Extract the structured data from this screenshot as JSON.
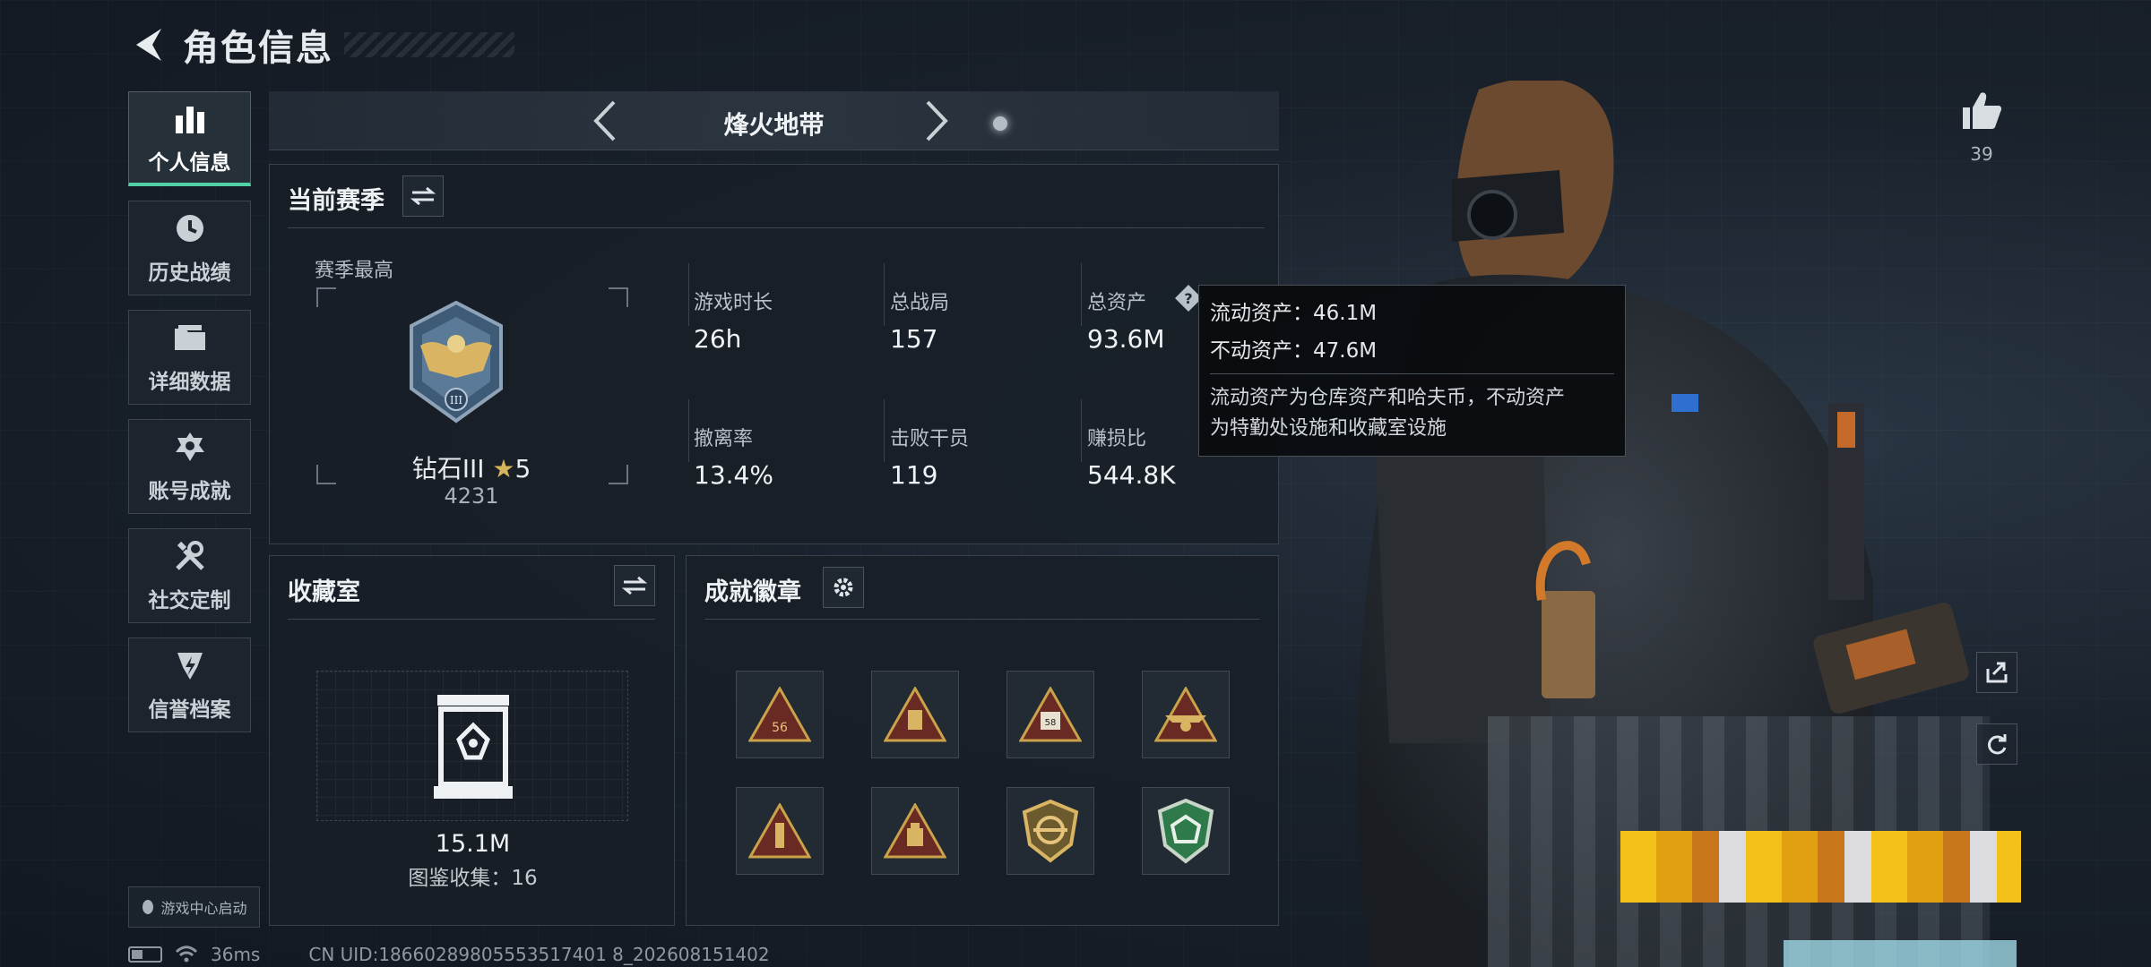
{
  "header": {
    "title": "角色信息"
  },
  "sidebar": {
    "items": [
      {
        "label": "个人信息",
        "icon": "bar-chart-icon",
        "active": true
      },
      {
        "label": "历史战绩",
        "icon": "clock-icon",
        "active": false
      },
      {
        "label": "详细数据",
        "icon": "folder-icon",
        "active": false
      },
      {
        "label": "账号成就",
        "icon": "achievement-icon",
        "active": false
      },
      {
        "label": "社交定制",
        "icon": "tools-icon",
        "active": false
      },
      {
        "label": "信誉档案",
        "icon": "credit-shield-icon",
        "active": false
      }
    ],
    "launch_label": "游戏中心启动"
  },
  "mode": {
    "title": "烽火地带"
  },
  "season": {
    "title": "当前赛季",
    "best_label": "赛季最高",
    "rank_name": "钻石III",
    "rank_stars": "5",
    "rank_score": "4231",
    "stats": [
      {
        "label": "游戏时长",
        "value": "26h"
      },
      {
        "label": "总战局",
        "value": "157"
      },
      {
        "label": "总资产",
        "value": "93.6M"
      },
      {
        "label": "撤离率",
        "value": "13.4%"
      },
      {
        "label": "击败干员",
        "value": "119"
      },
      {
        "label": "赚损比",
        "value": "544.8K"
      }
    ]
  },
  "tooltip": {
    "liquid": "流动资产：46.1M",
    "fixed": "不动资产：47.6M",
    "desc_line1": "流动资产为仓库资产和哈夫币，不动资产",
    "desc_line2": "为特勤处设施和收藏室设施"
  },
  "collection": {
    "title": "收藏室",
    "value": "15.1M",
    "collect_text": "图鉴收集：16"
  },
  "badges": {
    "title": "成就徽章",
    "items": [
      "badge-56",
      "badge-lantern",
      "badge-58",
      "badge-gold-wings",
      "badge-red-tower",
      "badge-red-lamp",
      "badge-gold-shield",
      "badge-green-shield"
    ]
  },
  "like": {
    "count": "39"
  },
  "status": {
    "ping": "36ms",
    "uid": "CN UID:18660289805553517401 8_202608151402"
  },
  "colors": {
    "accent": "#4fd1a3",
    "gold": "#c9a24a",
    "panel_bg": "#181f27"
  }
}
